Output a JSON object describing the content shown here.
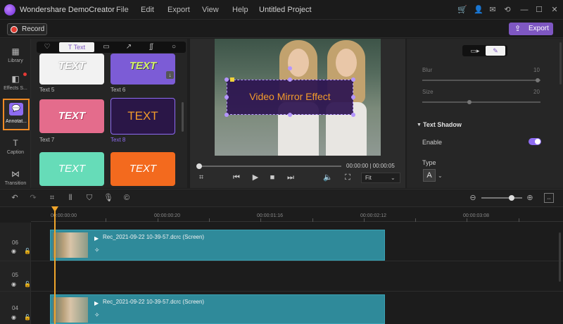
{
  "app": {
    "title": "Wondershare DemoCreator",
    "project": "Untitled Project"
  },
  "menu": [
    "File",
    "Edit",
    "Export",
    "View",
    "Help"
  ],
  "toolbar": {
    "record_label": "Record",
    "export_label": "Export"
  },
  "sidebar": {
    "items": [
      {
        "label": "Library",
        "icon": "library-icon"
      },
      {
        "label": "Effects S...",
        "icon": "effects-icon"
      },
      {
        "label": "Annotat...",
        "icon": "annotation-icon"
      },
      {
        "label": "Caption",
        "icon": "caption-icon"
      },
      {
        "label": "Transition",
        "icon": "transition-icon"
      }
    ]
  },
  "library": {
    "tabs": [
      "shape-heart-icon",
      "Text",
      "callout-icon",
      "arrow-icon",
      "sketch-icon",
      "circle-icon"
    ],
    "tiles": [
      {
        "caption": "Text 5",
        "text": "TEXT"
      },
      {
        "caption": "Text 6",
        "text": "TEXT"
      },
      {
        "caption": "Text 7",
        "text": "TEXT"
      },
      {
        "caption": "Text 8",
        "text": "TEXT"
      },
      {
        "caption": "",
        "text": "TEXT"
      },
      {
        "caption": "",
        "text": "TEXT"
      }
    ]
  },
  "preview": {
    "overlay_text": "Video Mirror Effect",
    "time": "00:00:00 | 00:00:05",
    "fit": "Fit"
  },
  "properties": {
    "blur": {
      "label": "Blur",
      "value": "10"
    },
    "size": {
      "label": "Size",
      "value": "20"
    },
    "text_shadow": "Text Shadow",
    "enable_label": "Enable",
    "type_label": "Type",
    "type_value": "A"
  },
  "timeline": {
    "ruler": [
      "00:00:00:00",
      "00:00:00:20",
      "00:00:01:16",
      "00:00:02:12",
      "00:00:03:08"
    ],
    "tracks": [
      {
        "number": "06",
        "clip": "Rec_2021-09-22 10-39-57.dcrc (Screen)"
      },
      {
        "number": "05",
        "clip": ""
      },
      {
        "number": "04",
        "clip": "Rec_2021-09-22 10-39-57.dcrc (Screen)"
      }
    ]
  },
  "colors": {
    "accent": "#7e57c2",
    "highlight": "#f08a24",
    "clip": "#2f8a9a",
    "playhead": "#f0a52b"
  }
}
